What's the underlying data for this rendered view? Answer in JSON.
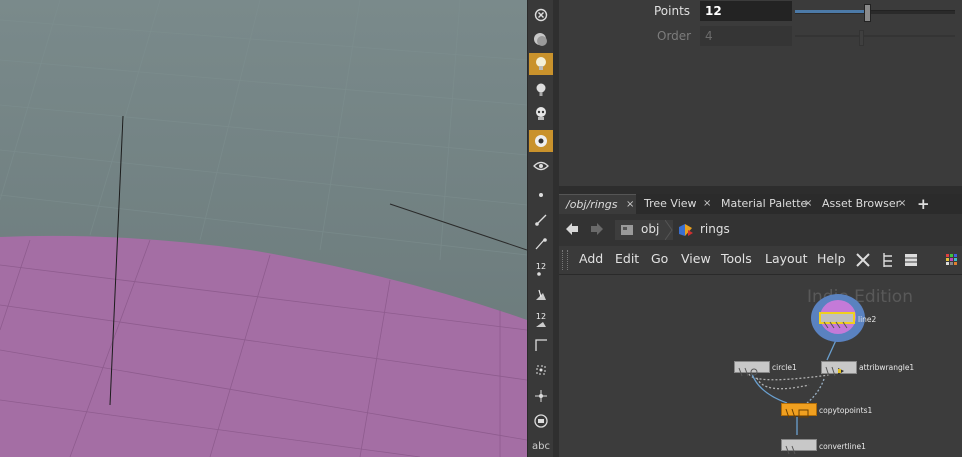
{
  "viewport": {
    "name": "scene-viewport"
  },
  "toolbar": {
    "bottom_label": "abc",
    "counter_a": "12",
    "counter_b": "12"
  },
  "params": {
    "points_label": "Points",
    "points_value": "12",
    "points_slider_fraction": 0.45,
    "order_label": "Order",
    "order_value": "4",
    "order_slider_fraction": 0.4
  },
  "tabs": [
    {
      "label": "/obj/rings",
      "active": true
    },
    {
      "label": "Tree View"
    },
    {
      "label": "Material Palette"
    },
    {
      "label": "Asset Browser"
    }
  ],
  "path": {
    "obj": "obj",
    "node": "rings"
  },
  "menu": [
    "Add",
    "Edit",
    "Go",
    "View",
    "Tools",
    "Layout",
    "Help"
  ],
  "network": {
    "watermark": "Indie Edition",
    "nodes": {
      "line2": "line2",
      "circle1": "circle1",
      "attribwrangle1": "attribwrangle1",
      "copytopoints1": "copytopoints1",
      "convertline1": "convertline1"
    }
  },
  "colors": {
    "accent": "#c9922c",
    "ground": "#a06aa0",
    "sky": "#6b7c7d",
    "node_orange": "#f0a020"
  }
}
